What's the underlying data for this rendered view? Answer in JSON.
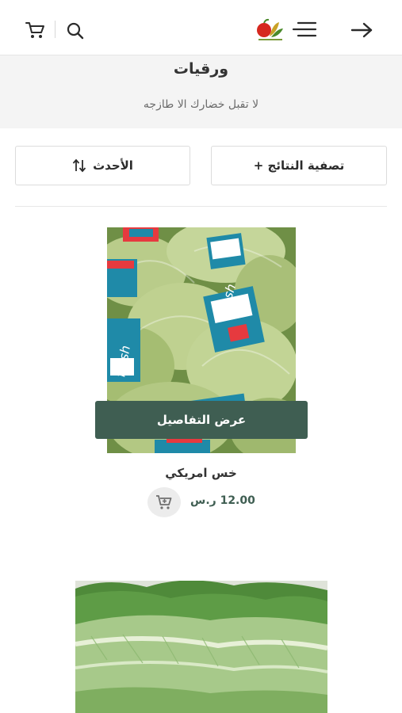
{
  "header": {
    "cart_icon": "cart-icon",
    "search_icon": "search-icon",
    "menu_icon": "hamburger-menu-icon",
    "back_icon": "arrow-right-icon",
    "logo": "store-logo"
  },
  "category": {
    "title": "ورقيات",
    "subtitle": "لا تقبل خضارك الا طازجه"
  },
  "toolbar": {
    "sort_label": "الأحدث",
    "sort_icon": "sort-arrows-icon",
    "filter_label": "تصفية النتائج +"
  },
  "products": [
    {
      "name": "خس امريكي",
      "price": "12.00 ر.س",
      "details_label": "عرض التفاصيل",
      "image": "iceberg-lettuce-photo"
    },
    {
      "image": "romaine-lettuce-photo"
    }
  ],
  "colors": {
    "accent": "#3f5e52",
    "banner_bg": "#f4f4f4",
    "cart_button_bg": "#ececec"
  }
}
